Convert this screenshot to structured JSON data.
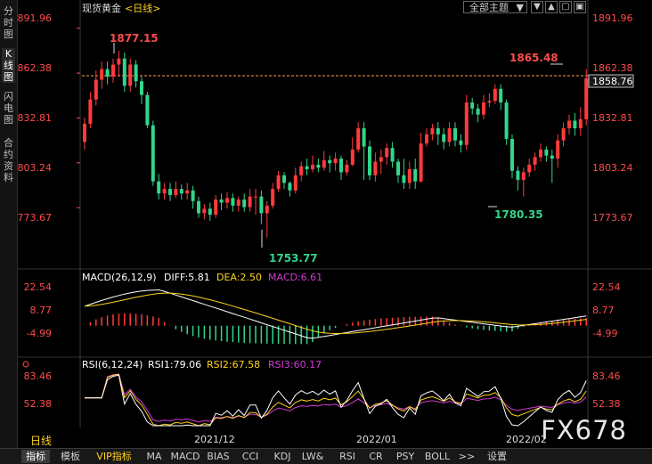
{
  "side_tabs": [
    "分时图",
    "K线图",
    "闪电图",
    "合约资料"
  ],
  "toolbar": {
    "title": "现货黄金",
    "period": "<日线>",
    "theme_button": "全部主题",
    "theme_arrow": "▼",
    "icons": [
      "▼",
      "▲",
      "▢",
      "▣"
    ]
  },
  "price_axis": {
    "labels": [
      "1891.96",
      "1862.38",
      "1832.81",
      "1803.24",
      "1773.67"
    ],
    "current_price": "1858.76",
    "ref_line": "1862.38"
  },
  "annotations": {
    "high": "1877.15",
    "recent_high": "1865.48",
    "low": "1753.77",
    "recent_low": "1780.35"
  },
  "macd": {
    "header": "MACD(26,12,9)",
    "diff": "DIFF:5.81",
    "dea": "DEA:2.50",
    "macd": "MACD:6.61",
    "axis": [
      "22.54",
      "8.77",
      "-4.99"
    ]
  },
  "rsi": {
    "header": "RSI(6,12,24)",
    "rsi1": "RSI1:79.06",
    "rsi2": "RSI2:67.58",
    "rsi3": "RSI3:60.17",
    "axis": [
      "83.46",
      "52.38"
    ]
  },
  "dates": [
    "2021/12",
    "2022/01",
    "2022/02"
  ],
  "period_label": "日线",
  "watermark": "FX678",
  "bottom_tabs": [
    "指标",
    "模板",
    "VIP指标",
    "MA",
    "MACD",
    "BIAS",
    "CCI",
    "KDJ",
    "LW&",
    "RSI",
    "CR",
    "PSY",
    "BOLL",
    ">>",
    "设置"
  ],
  "colors": {
    "up": "#ff3b3b",
    "down": "#33d58b",
    "axis_text": "#ff4b4b",
    "yellow": "#ffd21e",
    "magenta": "#d43bd4"
  },
  "chart_data": {
    "type": "candlestick",
    "title": "现货黄金 日线",
    "ylim": [
      1745,
      1900
    ],
    "candles": [
      [
        1817,
        1829,
        1812,
        1833
      ],
      [
        1829,
        1845,
        1826,
        1850
      ],
      [
        1845,
        1858,
        1841,
        1864
      ],
      [
        1858,
        1865,
        1852,
        1870
      ],
      [
        1865,
        1860,
        1855,
        1870
      ],
      [
        1860,
        1868,
        1856,
        1872
      ],
      [
        1868,
        1872,
        1860,
        1877
      ],
      [
        1872,
        1854,
        1850,
        1876
      ],
      [
        1854,
        1868,
        1850,
        1872
      ],
      [
        1868,
        1857,
        1853,
        1871
      ],
      [
        1857,
        1848,
        1842,
        1860
      ],
      [
        1848,
        1828,
        1826,
        1850
      ],
      [
        1828,
        1791,
        1788,
        1831
      ],
      [
        1791,
        1783,
        1779,
        1796
      ],
      [
        1783,
        1786,
        1779,
        1790
      ],
      [
        1786,
        1782,
        1778,
        1790
      ],
      [
        1782,
        1786,
        1780,
        1791
      ],
      [
        1786,
        1783,
        1779,
        1789
      ],
      [
        1783,
        1785,
        1779,
        1790
      ],
      [
        1785,
        1778,
        1773,
        1788
      ],
      [
        1778,
        1770,
        1767,
        1781
      ],
      [
        1770,
        1773,
        1766,
        1776
      ],
      [
        1773,
        1769,
        1765,
        1777
      ],
      [
        1769,
        1779,
        1767,
        1782
      ],
      [
        1779,
        1777,
        1772,
        1783
      ],
      [
        1777,
        1780,
        1773,
        1784
      ],
      [
        1780,
        1775,
        1771,
        1783
      ],
      [
        1775,
        1779,
        1771,
        1781
      ],
      [
        1779,
        1774,
        1771,
        1783
      ],
      [
        1774,
        1781,
        1771,
        1786
      ],
      [
        1781,
        1781,
        1769,
        1786
      ],
      [
        1781,
        1770,
        1763,
        1785
      ],
      [
        1770,
        1775,
        1754,
        1778
      ],
      [
        1775,
        1786,
        1773,
        1790
      ],
      [
        1786,
        1795,
        1784,
        1798
      ],
      [
        1795,
        1790,
        1786,
        1797
      ],
      [
        1790,
        1785,
        1781,
        1791
      ],
      [
        1785,
        1795,
        1783,
        1800
      ],
      [
        1795,
        1801,
        1791,
        1804
      ],
      [
        1801,
        1799,
        1795,
        1806
      ],
      [
        1799,
        1802,
        1797,
        1808
      ],
      [
        1802,
        1800,
        1797,
        1806
      ],
      [
        1800,
        1805,
        1798,
        1811
      ],
      [
        1805,
        1803,
        1797,
        1808
      ],
      [
        1803,
        1806,
        1798,
        1810
      ],
      [
        1806,
        1797,
        1792,
        1808
      ],
      [
        1797,
        1802,
        1795,
        1805
      ],
      [
        1802,
        1812,
        1801,
        1820
      ],
      [
        1812,
        1826,
        1810,
        1830
      ],
      [
        1826,
        1814,
        1792,
        1830
      ],
      [
        1814,
        1795,
        1792,
        1818
      ],
      [
        1795,
        1804,
        1791,
        1810
      ],
      [
        1804,
        1807,
        1796,
        1812
      ],
      [
        1807,
        1813,
        1802,
        1816
      ],
      [
        1813,
        1804,
        1800,
        1817
      ],
      [
        1804,
        1795,
        1790,
        1806
      ],
      [
        1795,
        1790,
        1786,
        1806
      ],
      [
        1790,
        1799,
        1786,
        1804
      ],
      [
        1799,
        1791,
        1786,
        1806
      ],
      [
        1791,
        1816,
        1790,
        1823
      ],
      [
        1816,
        1822,
        1814,
        1826
      ],
      [
        1822,
        1826,
        1818,
        1829
      ],
      [
        1826,
        1822,
        1815,
        1830
      ],
      [
        1822,
        1817,
        1812,
        1826
      ],
      [
        1817,
        1826,
        1814,
        1830
      ],
      [
        1826,
        1818,
        1814,
        1830
      ],
      [
        1818,
        1815,
        1810,
        1822
      ],
      [
        1815,
        1843,
        1812,
        1848
      ],
      [
        1843,
        1839,
        1835,
        1846
      ],
      [
        1839,
        1835,
        1830,
        1842
      ],
      [
        1835,
        1843,
        1832,
        1848
      ],
      [
        1843,
        1844,
        1840,
        1849
      ],
      [
        1844,
        1852,
        1842,
        1855
      ],
      [
        1852,
        1843,
        1838,
        1855
      ],
      [
        1843,
        1819,
        1815,
        1845
      ],
      [
        1819,
        1798,
        1793,
        1822
      ],
      [
        1798,
        1792,
        1785,
        1801
      ],
      [
        1792,
        1797,
        1781,
        1800
      ],
      [
        1797,
        1802,
        1794,
        1806
      ],
      [
        1802,
        1807,
        1798,
        1810
      ],
      [
        1807,
        1812,
        1804,
        1816
      ],
      [
        1812,
        1808,
        1804,
        1814
      ],
      [
        1808,
        1806,
        1790,
        1812
      ],
      [
        1806,
        1818,
        1800,
        1822
      ],
      [
        1818,
        1826,
        1814,
        1830
      ],
      [
        1826,
        1831,
        1822,
        1835
      ],
      [
        1831,
        1826,
        1821,
        1836
      ],
      [
        1826,
        1832,
        1821,
        1840
      ],
      [
        1832,
        1859,
        1828,
        1865
      ]
    ]
  }
}
